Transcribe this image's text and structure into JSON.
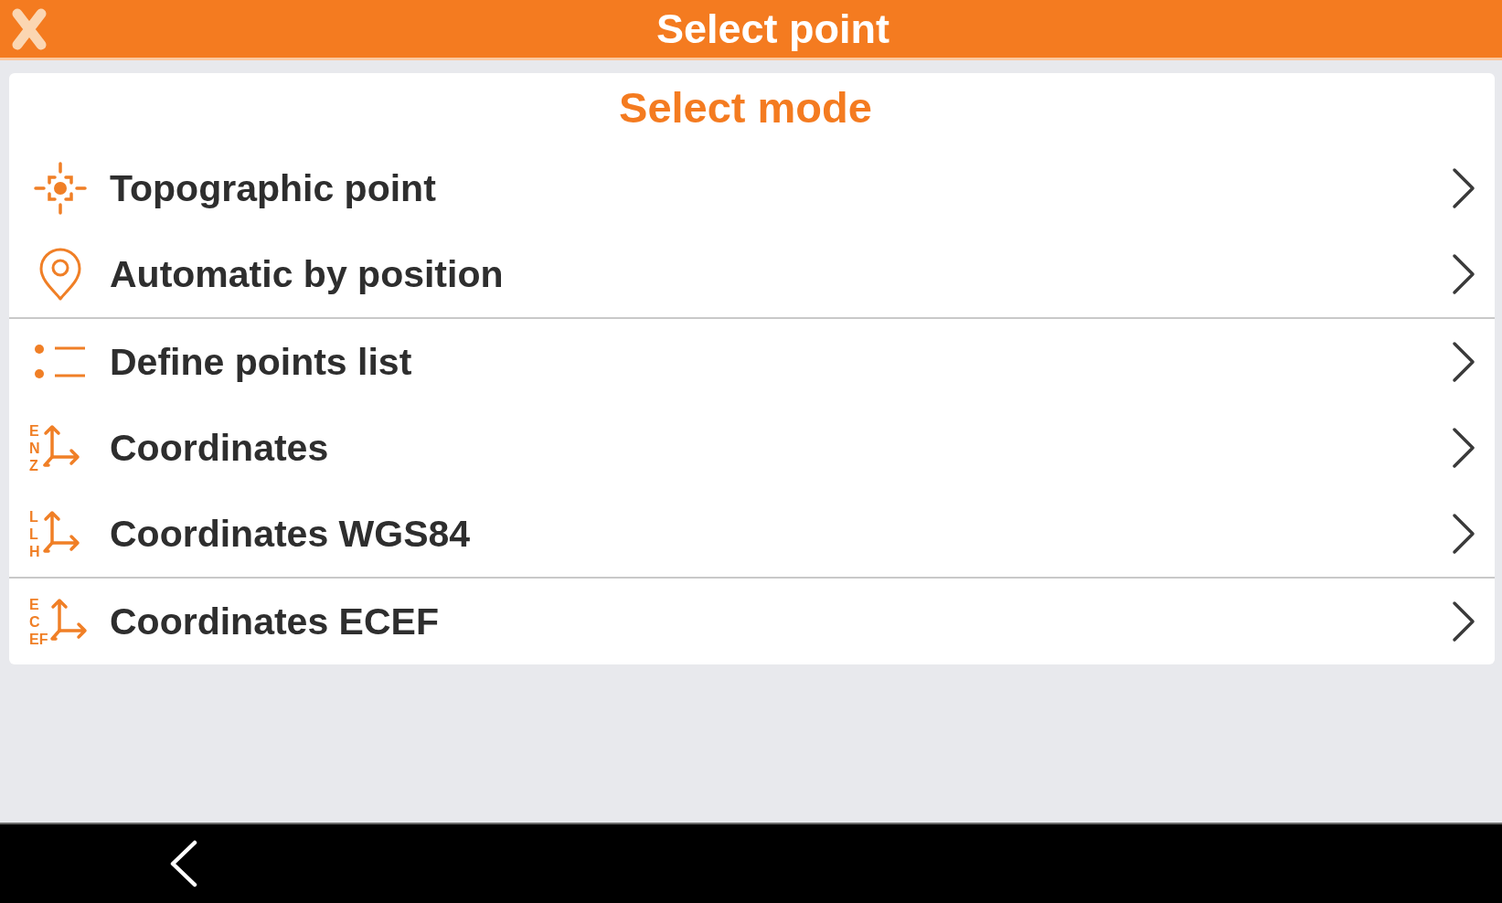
{
  "header": {
    "title": "Select point"
  },
  "card": {
    "title": "Select mode",
    "groups": [
      {
        "items": [
          {
            "kind": "target",
            "label": "Topographic point"
          },
          {
            "kind": "pin",
            "label": "Automatic by position"
          }
        ]
      },
      {
        "items": [
          {
            "kind": "list",
            "label": "Define points list"
          },
          {
            "kind": "axes",
            "label": "Coordinates",
            "axis_letters": [
              "E",
              "N",
              "Z"
            ]
          },
          {
            "kind": "axes",
            "label": "Coordinates WGS84",
            "axis_letters": [
              "L",
              "L",
              "H"
            ]
          }
        ]
      },
      {
        "items": [
          {
            "kind": "axes",
            "label": "Coordinates ECEF",
            "axis_letters": [
              "E",
              "C",
              "EF"
            ]
          }
        ]
      }
    ]
  }
}
